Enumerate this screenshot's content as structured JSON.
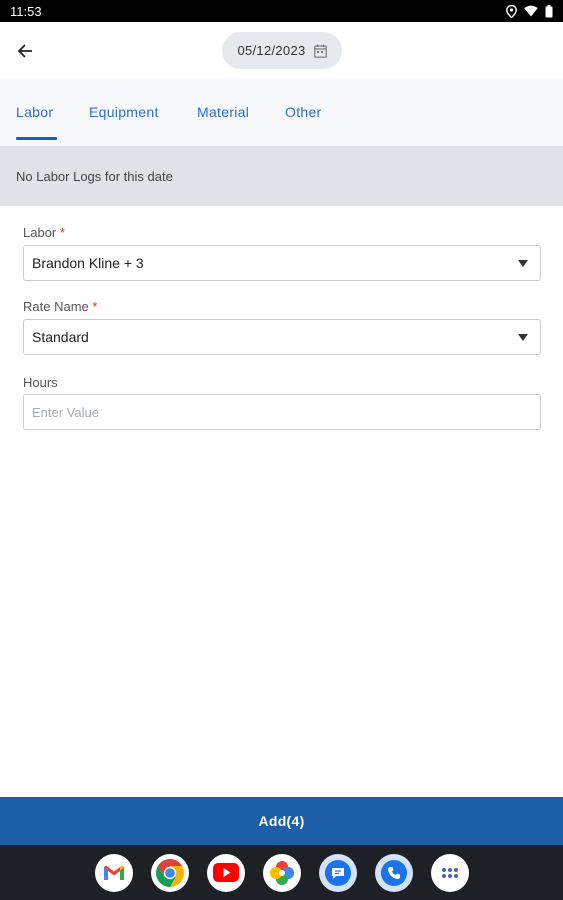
{
  "status_bar": {
    "time": "11:53"
  },
  "header": {
    "date": "05/12/2023"
  },
  "tabs": [
    {
      "label": "Labor",
      "active": true
    },
    {
      "label": "Equipment",
      "active": false
    },
    {
      "label": "Material",
      "active": false
    },
    {
      "label": "Other",
      "active": false
    }
  ],
  "empty_state": "No Labor Logs for this date",
  "form": {
    "labor": {
      "label": "Labor",
      "required_mark": "*",
      "value": "Brandon Kline + 3"
    },
    "rate_name": {
      "label": "Rate Name",
      "required_mark": "*",
      "value": "Standard"
    },
    "hours": {
      "label": "Hours",
      "placeholder": "Enter Value",
      "value": ""
    }
  },
  "add_button": {
    "label": "Add(4)"
  },
  "dock": [
    "gmail-icon",
    "chrome-icon",
    "youtube-icon",
    "photos-icon",
    "messages-icon",
    "phone-icon",
    "app-drawer-icon"
  ],
  "colors": {
    "accent": "#1c5ea8",
    "tab_text": "#2f6fc4",
    "required": "#d9381e"
  }
}
